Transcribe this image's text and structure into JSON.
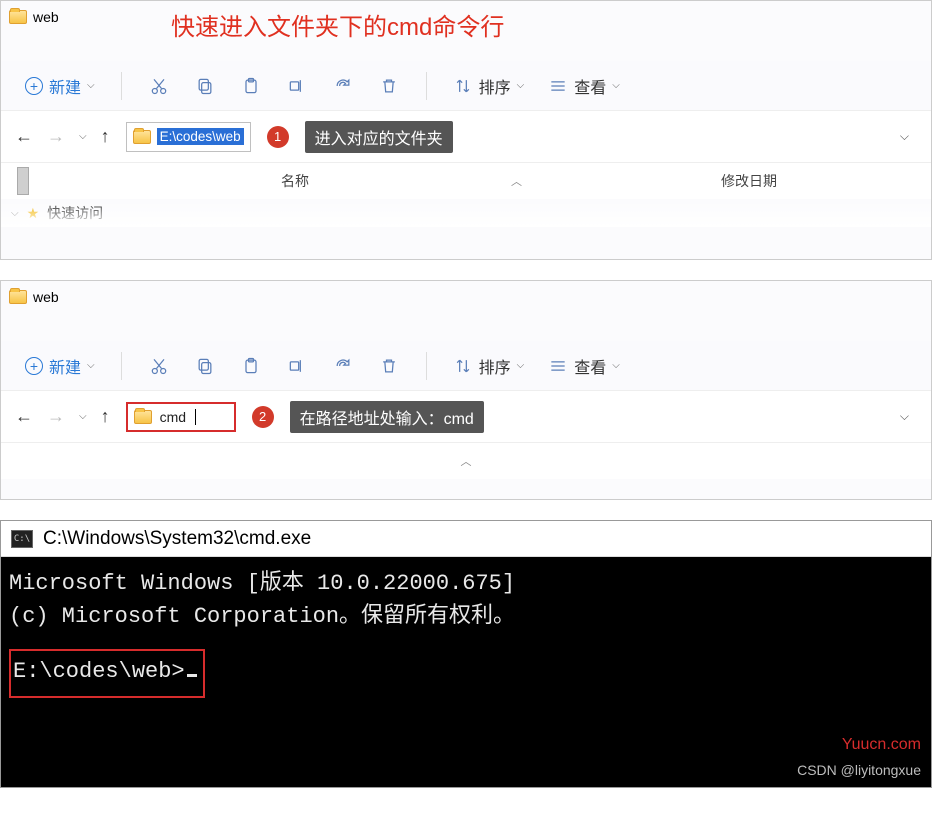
{
  "annotation_title": "快速进入文件夹下的cmd命令行",
  "explorer1": {
    "window_title": "web",
    "new_label": "新建",
    "sort_label": "排序",
    "view_label": "查看",
    "address_value": "E:\\codes\\web",
    "step_badge": "1",
    "step_text": "进入对应的文件夹",
    "col_name": "名称",
    "col_modified": "修改日期",
    "quick_access": "快速访问"
  },
  "explorer2": {
    "window_title": "web",
    "new_label": "新建",
    "sort_label": "排序",
    "view_label": "查看",
    "address_value": "cmd",
    "step_badge": "2",
    "step_text": "在路径地址处输入：cmd"
  },
  "cmd": {
    "title": "C:\\Windows\\System32\\cmd.exe",
    "line1": "Microsoft Windows [版本 10.0.22000.675]",
    "line2": "(c) Microsoft Corporation。保留所有权利。",
    "prompt": "E:\\codes\\web>",
    "watermark1": "Yuucn.com",
    "watermark2": "CSDN @liyitongxue"
  }
}
